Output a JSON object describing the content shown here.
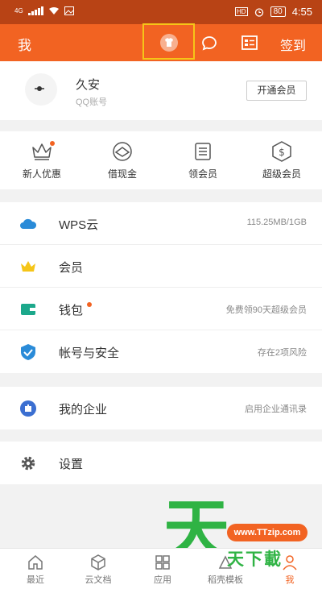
{
  "status_bar": {
    "network": "4G",
    "battery": "80",
    "time": "4:55"
  },
  "header": {
    "title": "我",
    "signin_label": "签到"
  },
  "profile": {
    "name": "久安",
    "account_type": "QQ账号",
    "vip_button": "开通会员"
  },
  "quick_actions": [
    {
      "label": "新人优惠",
      "icon": "crown-icon",
      "badge": true
    },
    {
      "label": "借现金",
      "icon": "diamond-icon",
      "badge": false
    },
    {
      "label": "领会员",
      "icon": "list-icon",
      "badge": false
    },
    {
      "label": "超级会员",
      "icon": "dollar-shield-icon",
      "badge": false
    }
  ],
  "menu_group_1": [
    {
      "label": "WPS云",
      "value": "115.25MB/1GB",
      "icon": "cloud-icon",
      "color": "#2a8bd8"
    },
    {
      "label": "会员",
      "value": "",
      "icon": "crown-icon",
      "color": "#f5c518"
    },
    {
      "label": "钱包",
      "value": "免费领90天超级会员",
      "icon": "wallet-icon",
      "color": "#1ca88b",
      "badge": true
    },
    {
      "label": "帐号与安全",
      "value": "存在2项风险",
      "icon": "shield-check-icon",
      "color": "#2a8bd8"
    }
  ],
  "menu_group_2": [
    {
      "label": "我的企业",
      "value": "启用企业通讯录",
      "icon": "enterprise-icon",
      "color": "#3b6fd1"
    }
  ],
  "menu_group_3": [
    {
      "label": "设置",
      "value": "",
      "icon": "gear-icon",
      "color": "#555"
    }
  ],
  "bottom_nav": [
    {
      "label": "最近",
      "icon": "home-icon"
    },
    {
      "label": "云文档",
      "icon": "cube-icon"
    },
    {
      "label": "应用",
      "icon": "grid-icon"
    },
    {
      "label": "稻壳模板",
      "icon": "template-icon"
    },
    {
      "label": "我",
      "icon": "person-icon",
      "active": true
    }
  ],
  "watermark": {
    "big": "天",
    "url": "www.TTzip.com",
    "text": "天下載"
  },
  "colors": {
    "accent": "#f26322",
    "status_bar": "#b84315"
  }
}
